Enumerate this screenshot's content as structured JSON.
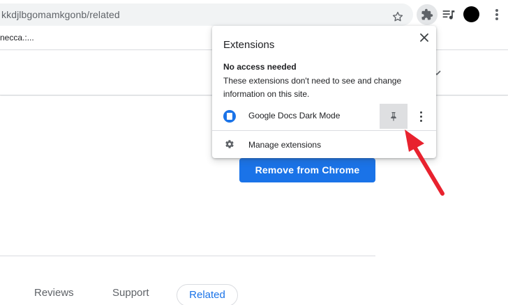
{
  "browser": {
    "url": "kkdjlbgomamkgonb/related",
    "bookmark_label": "necca.:..."
  },
  "page": {
    "remove_button_label": "Remove from Chrome",
    "tabs": [
      {
        "label": "Reviews"
      },
      {
        "label": "Support"
      },
      {
        "label": "Related",
        "active": true
      }
    ]
  },
  "extensions_popup": {
    "title": "Extensions",
    "section_heading": "No access needed",
    "section_description": "These extensions don't need to see and change information on this site.",
    "extension": {
      "name": "Google Docs Dark Mode",
      "icon": "google-docs-icon"
    },
    "manage_label": "Manage extensions"
  },
  "colors": {
    "accent": "#1a73e8",
    "annotation_arrow": "#e8222e"
  }
}
